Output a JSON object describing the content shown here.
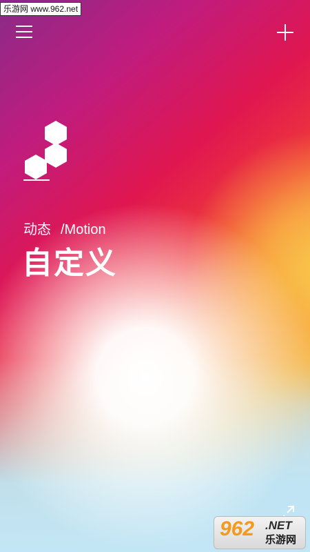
{
  "watermark_top": "乐游网 www.962.net",
  "header": {
    "menu_icon": "menu-icon",
    "add_icon": "plus-icon"
  },
  "logo": {
    "icon": "hexagon-cluster-icon"
  },
  "mode": {
    "label_cn": "动态",
    "label_en": "/Motion",
    "title": "自定义"
  },
  "footer": {
    "expand_icon": "expand-arrows-icon"
  },
  "watermark_badge": {
    "number": "962",
    "domain": ".NET",
    "name": "乐游网"
  },
  "colors": {
    "gradient_purple": "#8a2a88",
    "gradient_magenta": "#c01c7e",
    "gradient_red": "#e01650",
    "gradient_orange": "#f58a3a",
    "gradient_yellow": "#f9c84a",
    "gradient_lightblue": "#c3e6f6",
    "foreground": "#ffffff"
  }
}
